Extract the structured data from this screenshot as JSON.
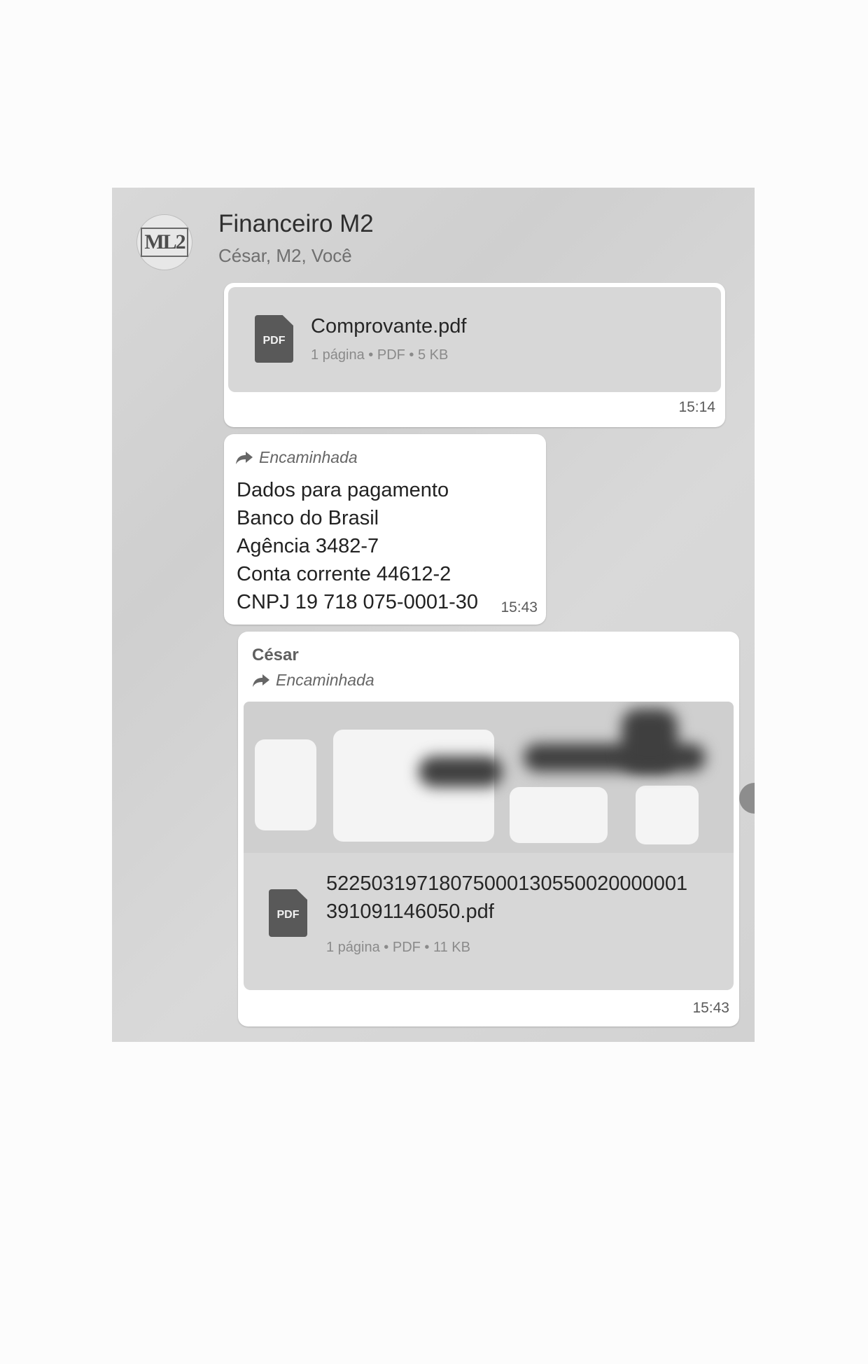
{
  "header": {
    "avatar_text": "ML2",
    "title": "Financeiro M2",
    "subtitle": "César, M2, Você"
  },
  "messages": [
    {
      "file": {
        "icon": "pdf-icon",
        "icon_label": "PDF",
        "name": "Comprovante.pdf",
        "meta": "1 página • PDF • 5 KB"
      },
      "time": "15:14"
    },
    {
      "forwarded_label": "Encaminhada",
      "lines": [
        "Dados para pagamento",
        "Banco do Brasil",
        "Agência 3482-7",
        "Conta corrente 44612-2",
        "CNPJ 19 718 075-0001-30"
      ],
      "time": "15:43"
    },
    {
      "sender": "César",
      "forwarded_label": "Encaminhada",
      "file": {
        "icon": "pdf-icon",
        "icon_label": "PDF",
        "name_line1": "52250319718075000130550020000001",
        "name_line2": "391091146050.pdf",
        "meta": "1 página • PDF • 11 KB"
      },
      "time": "15:43"
    }
  ]
}
